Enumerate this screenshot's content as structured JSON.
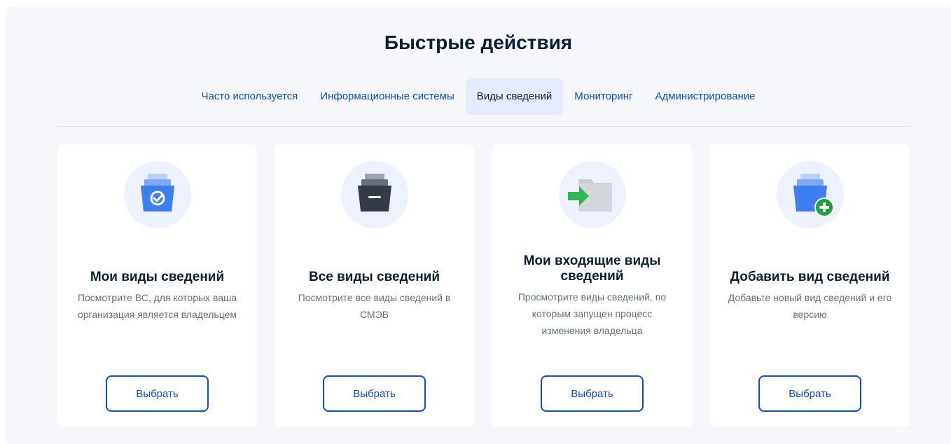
{
  "header": {
    "title": "Быстрые действия"
  },
  "tabs": [
    {
      "label": "Часто используется",
      "active": false
    },
    {
      "label": "Информационные системы",
      "active": false
    },
    {
      "label": "Виды сведений",
      "active": true
    },
    {
      "label": "Мониторинг",
      "active": false
    },
    {
      "label": "Администрирование",
      "active": false
    }
  ],
  "cards": [
    {
      "icon": "folder-check-icon",
      "title": "Мои виды сведений",
      "description": "Посмотрите ВС, для которых ваша организация является владельцем",
      "button_label": "Выбрать"
    },
    {
      "icon": "archive-box-icon",
      "title": "Все виды сведений",
      "description": "Посмотрите все виды сведений в СМЭВ",
      "button_label": "Выбрать"
    },
    {
      "icon": "folder-incoming-icon",
      "title": "Мои входящие виды сведений",
      "description": "Просмотрите виды сведений, по которым запущен процесс изменения владельца",
      "button_label": "Выбрать"
    },
    {
      "icon": "folder-add-icon",
      "title": "Добавить вид сведений",
      "description": "Добавьте новый вид сведений и его версию",
      "button_label": "Выбрать"
    }
  ],
  "colors": {
    "accent": "#0d4cd3",
    "active_tab_bg": "#e4ecfd",
    "heading": "#0b1f33",
    "muted_text": "#66727f",
    "add_badge": "#21a038",
    "incoming_arrow": "#2fb84f"
  }
}
